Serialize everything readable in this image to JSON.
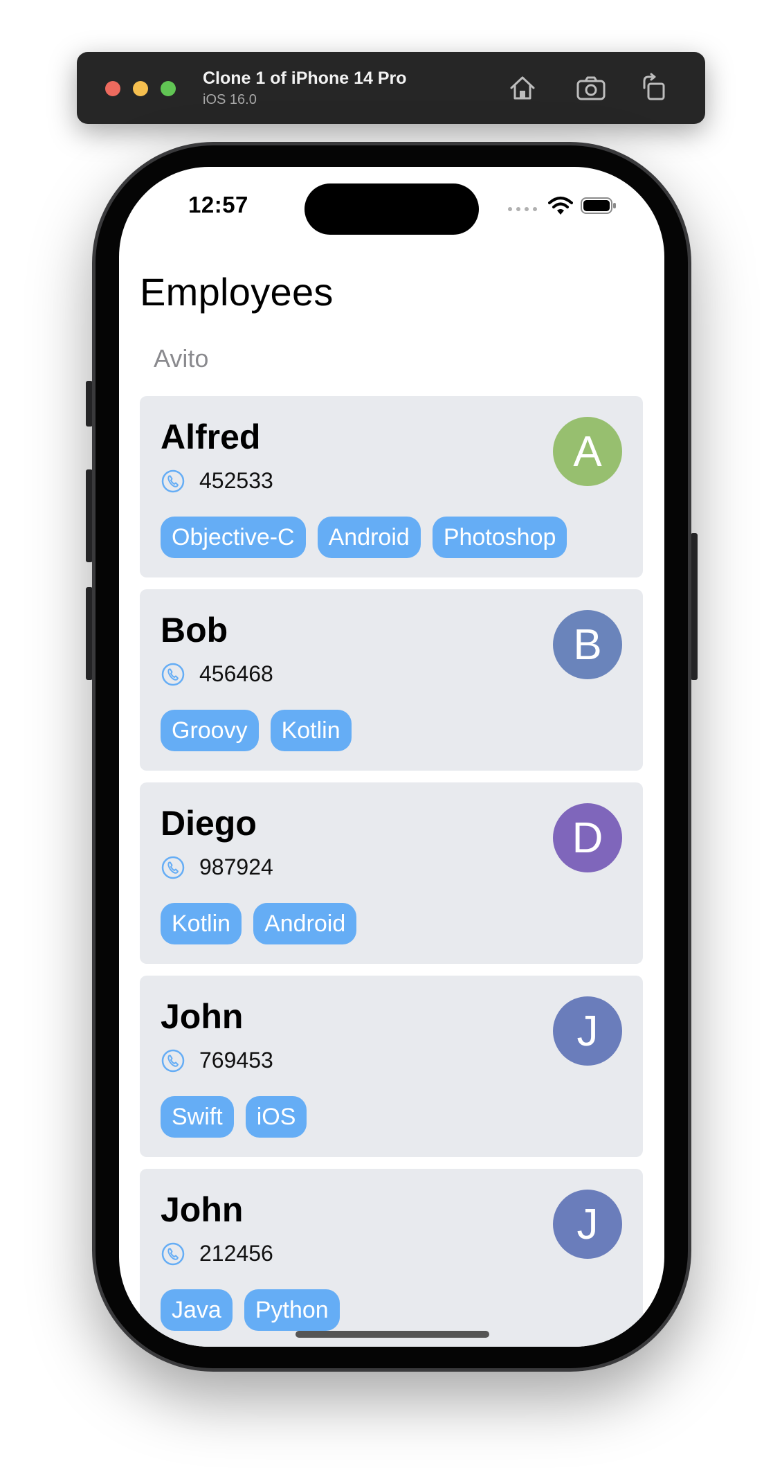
{
  "simulator": {
    "title": "Clone 1 of iPhone 14 Pro",
    "subtitle": "iOS 16.0",
    "icons": [
      "home-icon",
      "screenshot-icon",
      "rotate-icon"
    ]
  },
  "status_bar": {
    "time": "12:57",
    "icons": [
      "signal-dots-icon",
      "wifi-icon",
      "battery-icon"
    ]
  },
  "page": {
    "title": "Employees",
    "section": "Avito"
  },
  "employees": [
    {
      "name": "Alfred",
      "phone": "452533",
      "initial": "A",
      "avatar_color": "#97bf6f",
      "skills": [
        "Objective-C",
        "Android",
        "Photoshop"
      ]
    },
    {
      "name": "Bob",
      "phone": "456468",
      "initial": "B",
      "avatar_color": "#6a84bb",
      "skills": [
        "Groovy",
        "Kotlin"
      ]
    },
    {
      "name": "Diego",
      "phone": "987924",
      "initial": "D",
      "avatar_color": "#7f66bb",
      "skills": [
        "Kotlin",
        "Android"
      ]
    },
    {
      "name": "John",
      "phone": "769453",
      "initial": "J",
      "avatar_color": "#6a7dbb",
      "skills": [
        "Swift",
        "iOS"
      ]
    },
    {
      "name": "John",
      "phone": "212456",
      "initial": "J",
      "avatar_color": "#6a7dbb",
      "skills": [
        "Java",
        "Python"
      ]
    }
  ],
  "colors": {
    "card_bg": "#e8eaee",
    "tag_bg": "#65adf5",
    "phone_icon": "#65adf5"
  }
}
